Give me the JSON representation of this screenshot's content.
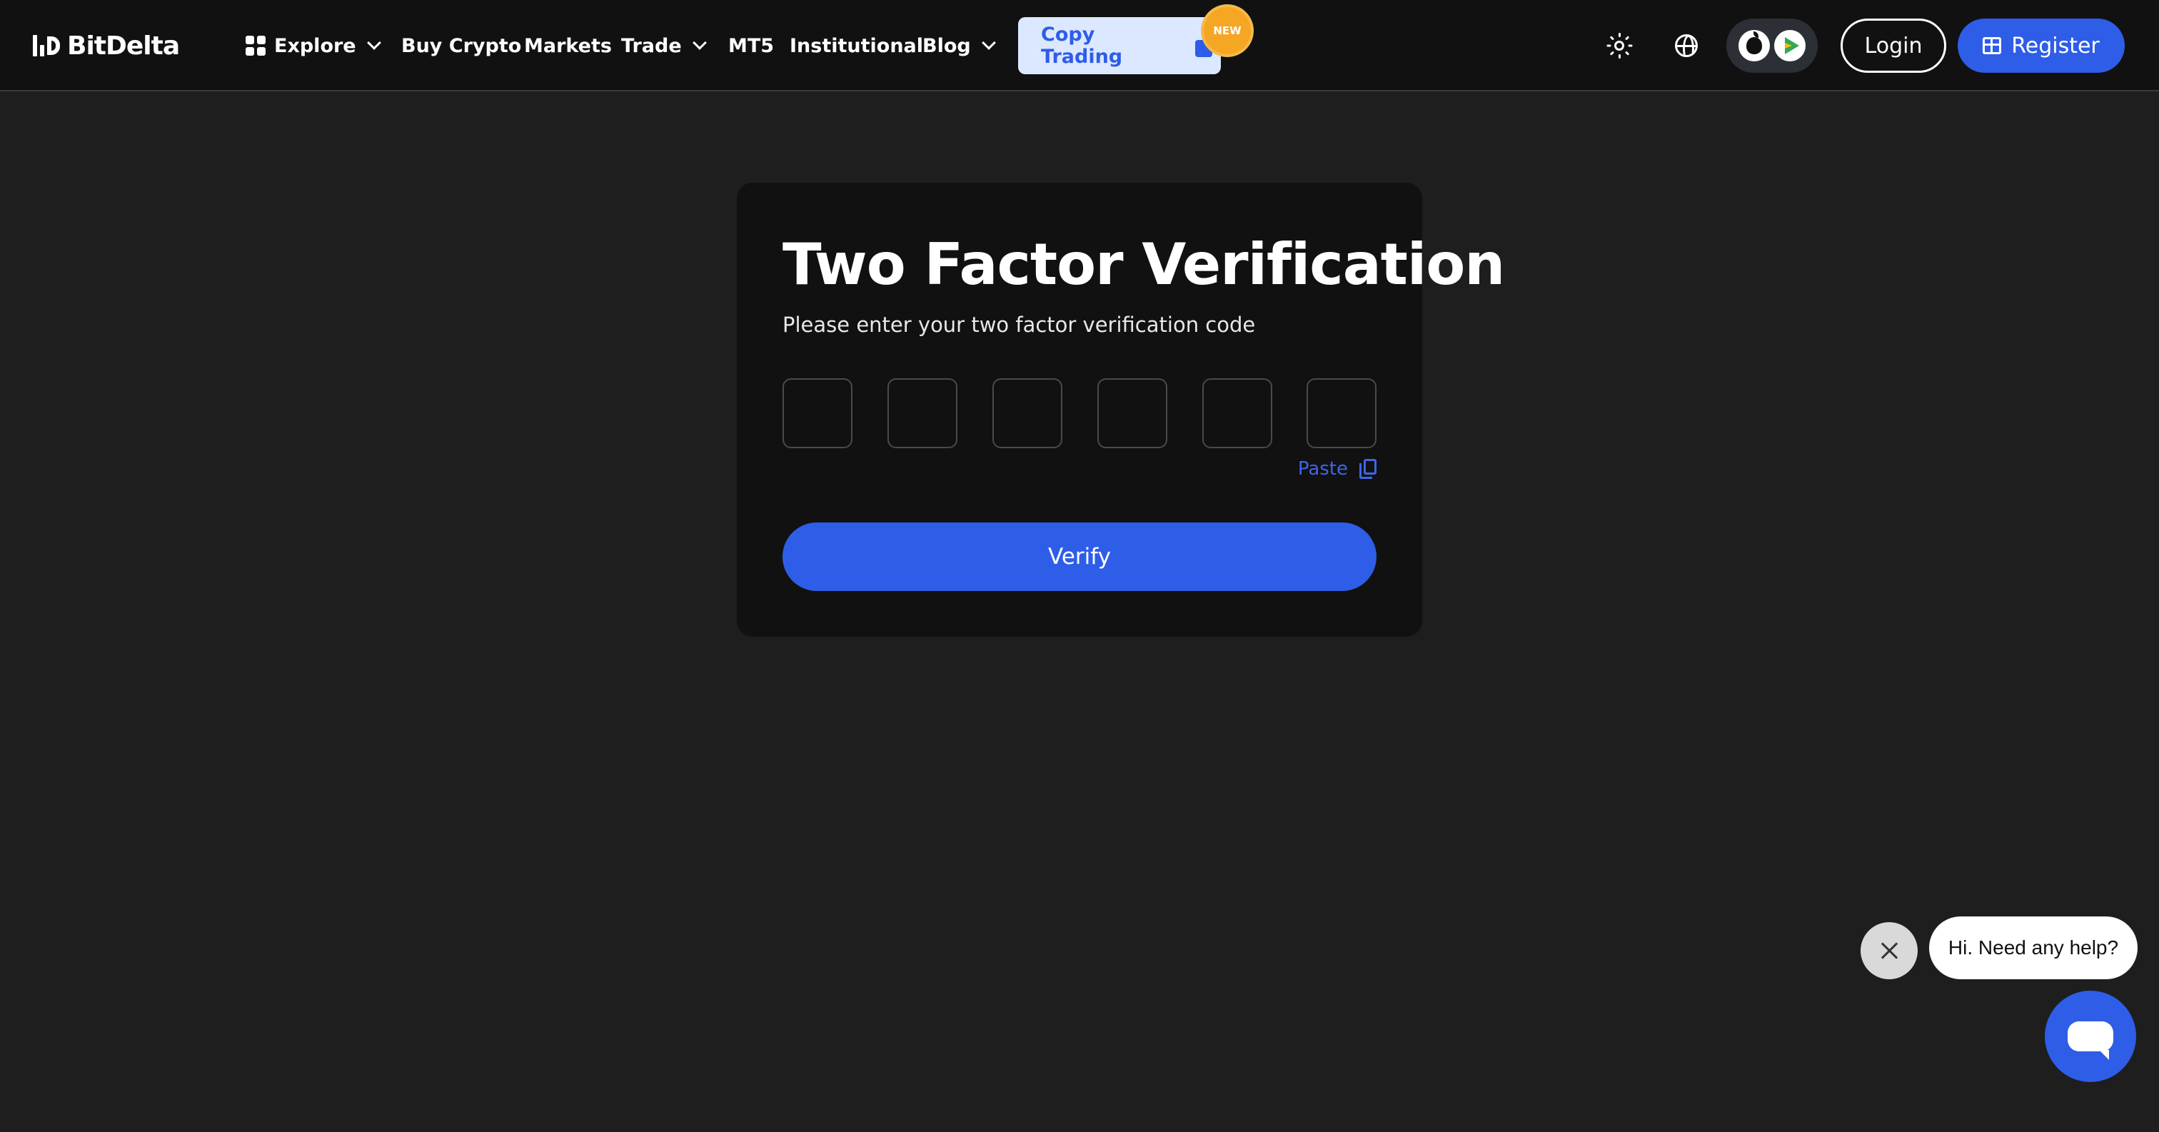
{
  "brand": {
    "name": "BitDelta"
  },
  "nav": {
    "explore": "Explore",
    "buy_crypto": "Buy Crypto",
    "markets": "Markets",
    "trade": "Trade",
    "mt5": "MT5",
    "institutional": "Institutional",
    "blog": "Blog",
    "copy_trading": "Copy Trading",
    "new_badge": "NEW"
  },
  "header_actions": {
    "theme_icon": "sun-icon",
    "language_icon": "globe-icon",
    "app_icons": [
      "apple-icon",
      "google-play-icon"
    ],
    "login": "Login",
    "register": "Register"
  },
  "verification": {
    "title": "Two Factor Verification",
    "subtitle": "Please enter your two factor verification code",
    "digits": [
      "",
      "",
      "",
      "",
      "",
      ""
    ],
    "paste": "Paste",
    "verify": "Verify"
  },
  "chat": {
    "greeting": "Hi. Need any help?"
  },
  "colors": {
    "accent": "#2e5de8",
    "background": "#1e1e1e",
    "header": "#111111",
    "card": "#111111",
    "badge": "#f5a623",
    "copy_trading_bg": "#dce8ff"
  }
}
